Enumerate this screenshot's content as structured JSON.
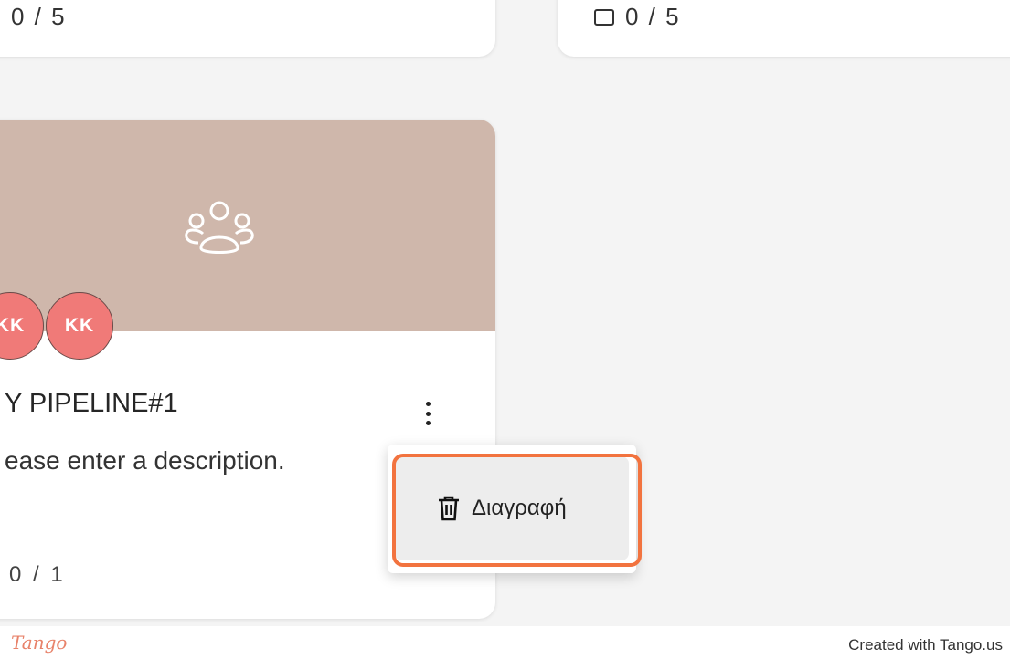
{
  "cards_row_top": {
    "left_count": "0 / 5",
    "right_count": "0 / 5"
  },
  "pipeline_card": {
    "cover_icon": "group-icon",
    "avatars": [
      "KK",
      "KK"
    ],
    "title": "Y PIPELINE#1",
    "description": "ease enter a description.",
    "count": "0 / 1",
    "menu_icon": "kebab-icon"
  },
  "context_menu": {
    "items": [
      {
        "label": "Διαγραφή",
        "icon": "trash-icon"
      }
    ]
  },
  "footer": {
    "logo": "Tango",
    "note": "Created with Tango.us"
  },
  "colors": {
    "cover": "#cfb7ab",
    "avatar": "#f07a78",
    "highlight": "#f2733f",
    "background": "#f4f4f4"
  }
}
